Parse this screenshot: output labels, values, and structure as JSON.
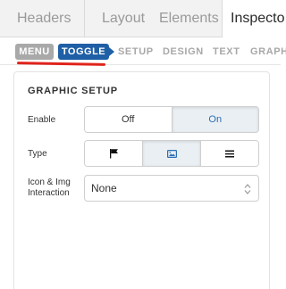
{
  "top_tabs": {
    "headers": "Headers",
    "layout": "Layout",
    "elements": "Elements",
    "inspector": "Inspecto"
  },
  "sub_nav": {
    "menu": "MENU",
    "toggle": "TOGGLE",
    "setup": "SETUP",
    "design": "DESIGN",
    "text": "TEXT",
    "graph": "GRAPH"
  },
  "panel": {
    "title": "GRAPHIC SETUP",
    "enable": {
      "label": "Enable",
      "options": [
        "Off",
        "On"
      ],
      "selected": "On"
    },
    "type": {
      "label": "Type",
      "options": [
        "flag-icon",
        "image-icon",
        "hamburger-icon"
      ],
      "selected": "image-icon"
    },
    "icon_img_interaction": {
      "label_line1": "Icon & Img",
      "label_line2": "Interaction",
      "value": "None"
    }
  },
  "colors": {
    "accent_blue": "#1f5fa6",
    "menu_pill_gray": "#a9a9a9",
    "annotation_red": "#e0231c",
    "selected_blue_text": "#2a6fb5"
  }
}
